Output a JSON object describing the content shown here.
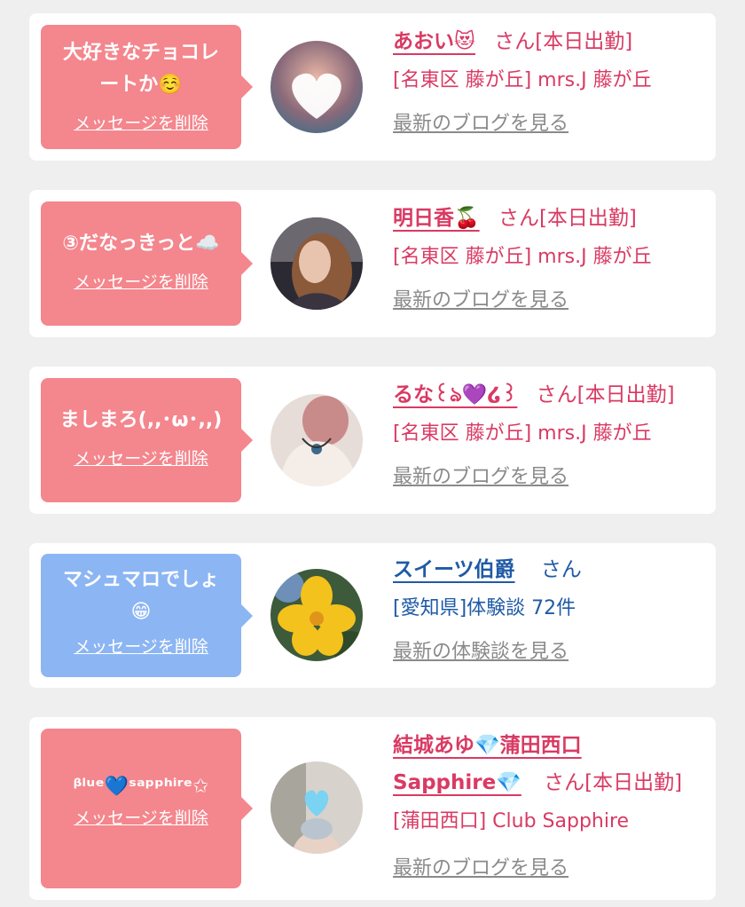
{
  "colors": {
    "pink_bubble": "#f4868d",
    "blue_bubble": "#8cb5f3",
    "pink_text": "#d93a63",
    "blue_text": "#1f5aa6",
    "link_gray": "#8a8a8a",
    "background": "#efefef"
  },
  "delete_label": "メッセージを削除",
  "items": [
    {
      "message_line1": "大好きなチョコレ",
      "message_line2": "ートか☺️",
      "name": "あおい😻",
      "honorific": "さん[本日出勤]",
      "location": "[名東区 藤が丘] mrs.J 藤が丘",
      "link": "最新のブログを見る",
      "avatar_icon": "avatar-heart-blur"
    },
    {
      "message_line1": "③だなっきっと☁️",
      "message_line2": "",
      "name": "明日香🍒",
      "honorific": "さん[本日出勤]",
      "location": "[名東区 藤が丘] mrs.J 藤が丘",
      "link": "最新のブログを見る",
      "avatar_icon": "avatar-photo"
    },
    {
      "message_line1": "ましまろ(,,･ω･,,)",
      "message_line2": "",
      "name": "るな꒰ঌ💜໒꒱",
      "honorific": "さん[本日出勤]",
      "location": "[名東区 藤が丘] mrs.J 藤が丘",
      "link": "最新のブログを見る",
      "avatar_icon": "avatar-photo"
    },
    {
      "message_line1": "マシュマロでしょ",
      "message_line2": "😁",
      "name": "スイーツ伯爵",
      "honorific": "さん",
      "location": "[愛知県]体験談 72件",
      "link": "最新の体験談を見る",
      "avatar_icon": "avatar-flower"
    },
    {
      "message_line1": "ᵝˡᵘᵉ💙ˢᵃᵖᵖʰⁱʳᵉ✩",
      "message_line2": "",
      "name": "結城あゆ💎蒲田西口",
      "name_line2": "Sapphire💎",
      "honorific": "さん[本日出勤]",
      "location": "[蒲田西口] Club Sapphire",
      "link": "最新のブログを見る",
      "avatar_icon": "avatar-heart-blur"
    }
  ]
}
